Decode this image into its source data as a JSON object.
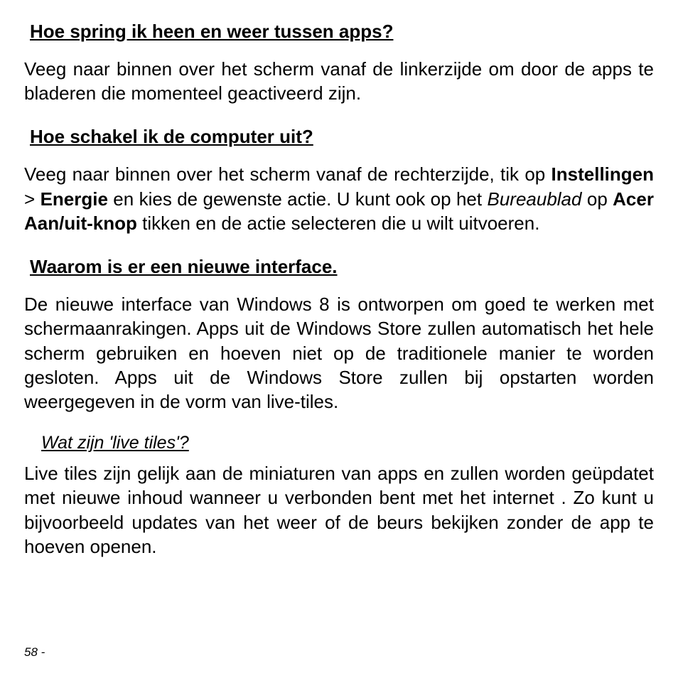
{
  "section1": {
    "heading": "Hoe spring ik heen en weer tussen apps?",
    "para": "Veeg naar binnen over het scherm vanaf de linkerzijde om door de apps te bladeren die momenteel geactiveerd zijn."
  },
  "section2": {
    "heading": "Hoe schakel ik de computer uit?",
    "para_pre": "Veeg naar binnen over het scherm vanaf de rechterzijde, tik op ",
    "instellingen": "Instellingen",
    "gt": " > ",
    "energie": "Energie",
    "mid1": " en kies de gewenste actie. U kunt ook op het ",
    "bureaublad": "Bureaublad",
    "mid2": " op ",
    "acer": "Acer Aan/uit-knop",
    "tail": " tikken en de actie selecteren die u wilt uitvoeren."
  },
  "section3": {
    "heading": "Waarom is er een nieuwe interface.",
    "para": "De nieuwe interface van Windows 8 is ontworpen om goed te werken met schermaanrakingen. Apps uit de Windows Store  zullen automatisch het hele scherm gebruiken en hoeven niet op de traditionele manier te worden gesloten. Apps uit de Windows Store zullen bij opstarten worden weergegeven in de vorm van live-tiles."
  },
  "section4": {
    "subheading": "Wat zijn 'live tiles'?",
    "para": "Live tiles zijn gelijk aan de miniaturen van apps en zullen worden geüpdatet met nieuwe inhoud wanneer u verbonden bent met het internet . Zo kunt u bijvoorbeeld updates van het weer of de beurs bekijken zonder de app te hoeven openen."
  },
  "page_number": "58 - "
}
